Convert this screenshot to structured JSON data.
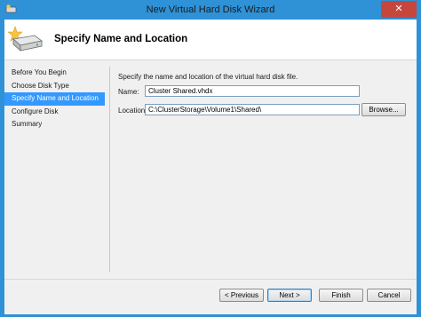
{
  "window": {
    "title": "New Virtual Hard Disk Wizard",
    "close_glyph": "✕"
  },
  "header": {
    "title": "Specify Name and Location"
  },
  "steps": [
    {
      "label": "Before You Begin",
      "active": false
    },
    {
      "label": "Choose Disk Type",
      "active": false
    },
    {
      "label": "Specify Name and Location",
      "active": true
    },
    {
      "label": "Configure Disk",
      "active": false
    },
    {
      "label": "Summary",
      "active": false
    }
  ],
  "content": {
    "instruction": "Specify the name and location of the virtual hard disk file.",
    "name_label": "Name:",
    "name_value": "Cluster Shared.vhdx",
    "location_label": "Location:",
    "location_value": "C:\\ClusterStorage\\Volume1\\Shared\\",
    "browse_label": "Browse..."
  },
  "footer": {
    "previous_label": "< Previous",
    "next_label": "Next >",
    "finish_label": "Finish",
    "cancel_label": "Cancel"
  },
  "colors": {
    "titlebar": "#2f91d6",
    "selection": "#3399ff",
    "close": "#c7463c"
  },
  "icons": {
    "app": "disk-wizard-icon",
    "header": "hard-disk-star-icon"
  }
}
